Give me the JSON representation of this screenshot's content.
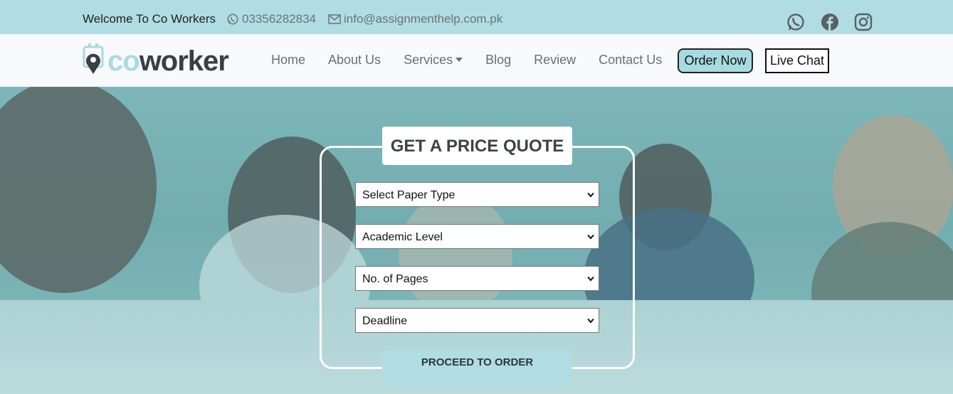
{
  "topbar": {
    "welcome": "Welcome To Co Workers",
    "phone": "03356282834",
    "email": "info@assignmenthelp.com.pk",
    "icons": [
      "whatsapp-icon",
      "facebook-icon",
      "instagram-icon"
    ]
  },
  "brand": {
    "prefix": "co",
    "suffix": "worker"
  },
  "nav": {
    "home": "Home",
    "about": "About Us",
    "services": "Services",
    "blog": "Blog",
    "review": "Review",
    "contact": "Contact Us",
    "order_now": "Order Now",
    "live_chat": "Live Chat"
  },
  "quote": {
    "title": "GET A PRICE QUOTE",
    "paper_type": "Select Paper Type",
    "academic_level": "Academic Level",
    "pages": "No. of Pages",
    "deadline": "Deadline",
    "proceed": "PROCEED TO ORDER"
  },
  "colors": {
    "accent": "#b0dde3",
    "dark_text": "#3a3f44"
  }
}
